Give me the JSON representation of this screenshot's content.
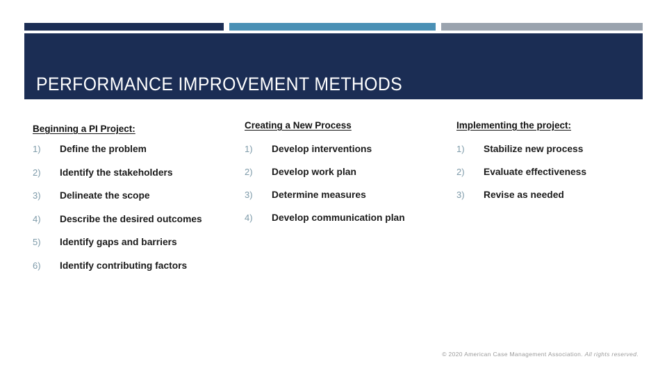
{
  "slide": {
    "title": "PERFORMANCE IMPROVEMENT METHODS"
  },
  "colors": {
    "navy": "#1b2d54",
    "blue": "#4a90b5",
    "gray": "#9aa3ae",
    "number": "#7d9aa9",
    "text": "#1a1a1a",
    "footer": "#9b9b9b"
  },
  "columns": [
    {
      "header": "Beginning a PI Project:",
      "items": [
        {
          "number": "1)",
          "text": "Define the problem"
        },
        {
          "number": "2)",
          "text": "Identify the stakeholders"
        },
        {
          "number": "3)",
          "text": "Delineate the scope"
        },
        {
          "number": "4)",
          "text": "Describe the desired outcomes"
        },
        {
          "number": "5)",
          "text": "Identify gaps and barriers"
        },
        {
          "number": "6)",
          "text": "Identify contributing factors"
        }
      ]
    },
    {
      "header": "Creating a New Process",
      "items": [
        {
          "number": "1)",
          "text": "Develop interventions"
        },
        {
          "number": "2)",
          "text": "Develop work plan"
        },
        {
          "number": "3)",
          "text": "Determine measures"
        },
        {
          "number": "4)",
          "text": "Develop communication plan"
        }
      ]
    },
    {
      "header": "Implementing the project:",
      "items": [
        {
          "number": "1)",
          "text": "Stabilize new process"
        },
        {
          "number": "2)",
          "text": "Evaluate effectiveness"
        },
        {
          "number": "3)",
          "text": "Revise as needed"
        }
      ]
    }
  ],
  "footer": {
    "copyright": "© 2020 American Case Management Association.",
    "rights": "All rights reserved",
    "period": "."
  }
}
